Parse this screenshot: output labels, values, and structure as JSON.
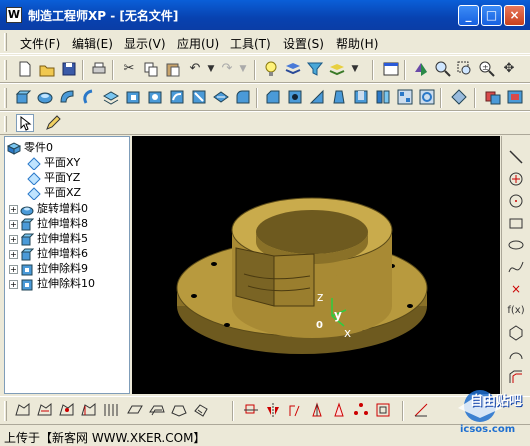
{
  "window": {
    "icon_letter": "W",
    "title": "制造工程师XP  - [无名文件]",
    "minimize": "_",
    "maximize": "□",
    "close": "×"
  },
  "menu": {
    "items": [
      "文件(F)",
      "编辑(E)",
      "显示(V)",
      "应用(U)",
      "工具(T)",
      "设置(S)",
      "帮助(H)"
    ]
  },
  "tree": {
    "items": [
      {
        "label": "零件0",
        "icon": "part-icon",
        "expander": ""
      },
      {
        "label": "平面XY",
        "icon": "plane-icon",
        "expander": ""
      },
      {
        "label": "平面YZ",
        "icon": "plane-icon",
        "expander": ""
      },
      {
        "label": "平面XZ",
        "icon": "plane-icon",
        "expander": ""
      },
      {
        "label": "旋转增料0",
        "icon": "revolve-icon",
        "expander": "+"
      },
      {
        "label": "拉伸增料8",
        "icon": "extrude-icon",
        "expander": "+"
      },
      {
        "label": "拉伸增料5",
        "icon": "extrude-icon",
        "expander": "+"
      },
      {
        "label": "拉伸增料6",
        "icon": "extrude-icon",
        "expander": "+"
      },
      {
        "label": "拉伸除料9",
        "icon": "cut-extrude-icon",
        "expander": "+"
      },
      {
        "label": "拉伸除料10",
        "icon": "cut-extrude-icon",
        "expander": "+"
      }
    ]
  },
  "viewport": {
    "axis_z": "z",
    "axis_y": "y",
    "origin": "0",
    "axis_x": "x",
    "model_color": "#b89a3e"
  },
  "status": {
    "text": "上传于【新客网 WWW.XKER.COM】"
  },
  "watermark": {
    "line1": "自由贴吧",
    "line2": "icsos.com"
  },
  "colors": {
    "titlebar": "#0842b0",
    "chrome": "#ece9d8",
    "viewport_bg": "#000000",
    "model": "#b89a3e"
  }
}
